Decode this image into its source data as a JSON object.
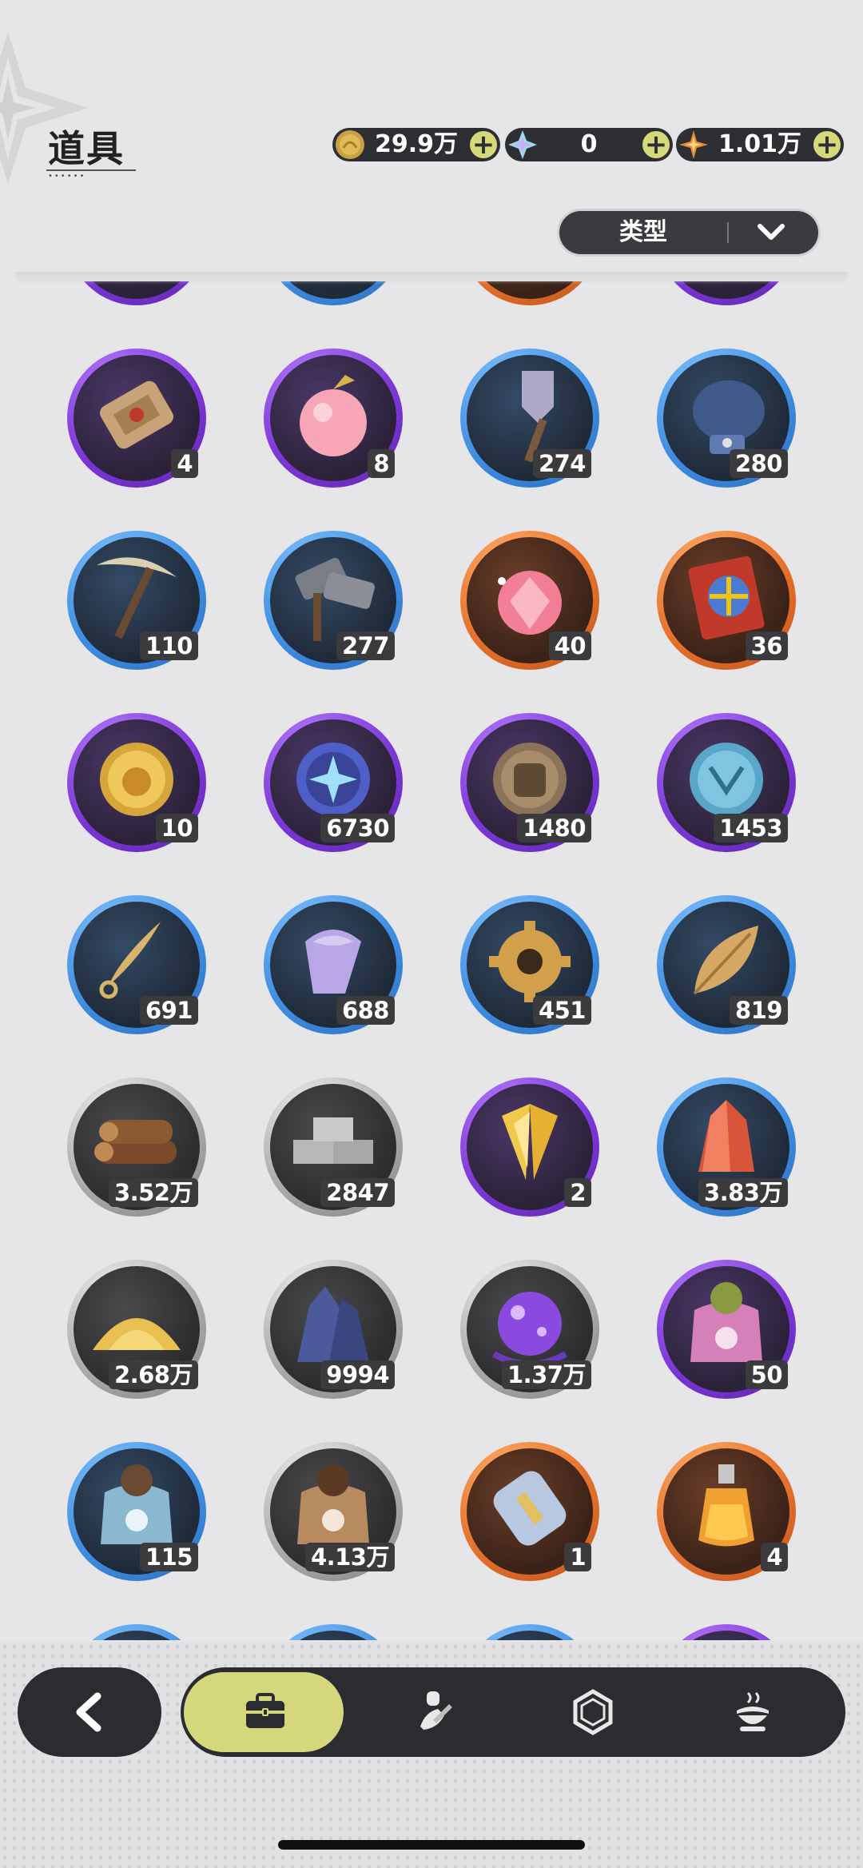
{
  "header": {
    "title": "道具",
    "currencies": [
      {
        "icon": "gold-coin-icon",
        "value": "29.9万"
      },
      {
        "icon": "crystal-star-icon",
        "value": "0"
      },
      {
        "icon": "orange-star-icon",
        "value": "1.01万"
      }
    ],
    "filter": {
      "label": "类型"
    }
  },
  "items": [
    {
      "icon": "scroll-icon",
      "rarity": "purple",
      "count": "4"
    },
    {
      "icon": "pink-apple-icon",
      "rarity": "purple",
      "count": "8"
    },
    {
      "icon": "shovel-icon",
      "rarity": "blue",
      "count": "274"
    },
    {
      "icon": "gauntlet-icon",
      "rarity": "blue",
      "count": "280"
    },
    {
      "icon": "pickaxe-icon",
      "rarity": "blue",
      "count": "110"
    },
    {
      "icon": "hammer-icon",
      "rarity": "blue",
      "count": "277"
    },
    {
      "icon": "crystal-apple-icon",
      "rarity": "orange",
      "count": "40"
    },
    {
      "icon": "lottery-ticket-icon",
      "rarity": "orange",
      "count": "36"
    },
    {
      "icon": "gold-medal-icon",
      "rarity": "purple",
      "count": "10"
    },
    {
      "icon": "star-orb-icon",
      "rarity": "purple",
      "count": "6730"
    },
    {
      "icon": "fist-coin-icon",
      "rarity": "purple",
      "count": "1480"
    },
    {
      "icon": "rune-coin-icon",
      "rarity": "purple",
      "count": "1453"
    },
    {
      "icon": "fang-icon",
      "rarity": "blue",
      "count": "691"
    },
    {
      "icon": "scale-shard-icon",
      "rarity": "blue",
      "count": "688"
    },
    {
      "icon": "gear-icon",
      "rarity": "blue",
      "count": "451"
    },
    {
      "icon": "leaf-icon",
      "rarity": "blue",
      "count": "819"
    },
    {
      "icon": "wood-logs-icon",
      "rarity": "gray",
      "count": "3.52万"
    },
    {
      "icon": "stone-bricks-icon",
      "rarity": "gray",
      "count": "2847"
    },
    {
      "icon": "gold-crystal-icon",
      "rarity": "purple",
      "count": "2"
    },
    {
      "icon": "red-crystal-icon",
      "rarity": "blue",
      "count": "3.83万"
    },
    {
      "icon": "sand-pile-icon",
      "rarity": "gray",
      "count": "2.68万"
    },
    {
      "icon": "ore-crystal-icon",
      "rarity": "gray",
      "count": "9994"
    },
    {
      "icon": "magic-orb-icon",
      "rarity": "gray",
      "count": "1.37万"
    },
    {
      "icon": "pink-feed-bag-icon",
      "rarity": "purple",
      "count": "50"
    },
    {
      "icon": "blue-feed-bag-icon",
      "rarity": "blue",
      "count": "115"
    },
    {
      "icon": "brown-feed-bag-icon",
      "rarity": "gray",
      "count": "4.13万"
    },
    {
      "icon": "cloth-roll-icon",
      "rarity": "orange",
      "count": "1"
    },
    {
      "icon": "potion-bottle-icon",
      "rarity": "orange",
      "count": "4"
    }
  ],
  "partial_rows": {
    "top": [
      "purple",
      "blue",
      "orange",
      "purple"
    ],
    "bottom": [
      "blue",
      "blue",
      "blue",
      "purple"
    ]
  },
  "nav": {
    "back": "back-chevron-icon",
    "tabs": [
      {
        "icon": "briefcase-icon",
        "active": true
      },
      {
        "icon": "chef-knife-icon",
        "active": false
      },
      {
        "icon": "hexagon-gem-icon",
        "active": false
      },
      {
        "icon": "cooking-pot-icon",
        "active": false
      }
    ]
  },
  "colors": {
    "accent": "#d4d77c",
    "dark": "#2b2c30",
    "rarity_purple": "#7b36d6",
    "rarity_blue": "#3e8ce0",
    "rarity_orange": "#e46f2a",
    "rarity_gray": "#a9a9ab"
  }
}
